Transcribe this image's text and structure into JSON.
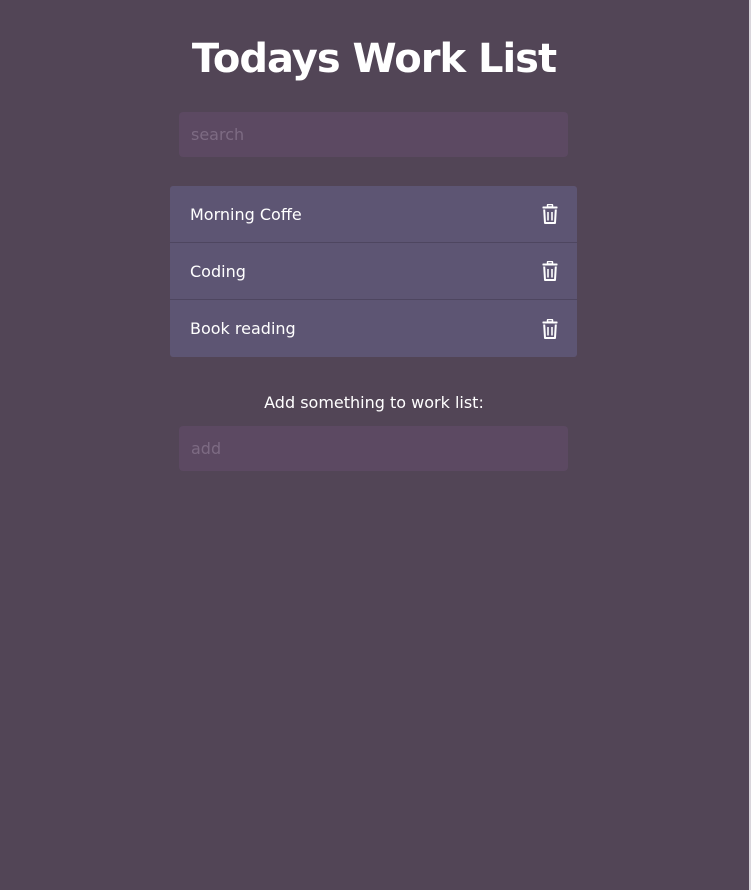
{
  "header": {
    "title": "Todays Work List"
  },
  "search": {
    "placeholder": "search",
    "value": ""
  },
  "todos": [
    {
      "label": "Morning Coffe",
      "action_icon": "trash-icon"
    },
    {
      "label": "Coding",
      "action_icon": "trash-icon"
    },
    {
      "label": "Book reading",
      "action_icon": "trash-icon"
    }
  ],
  "add": {
    "label": "Add something to work list:",
    "placeholder": "add",
    "value": ""
  },
  "colors": {
    "background": "#524556",
    "input_background": "#5c4962",
    "list_item_background": "#5d5573",
    "text": "#ffffff"
  }
}
